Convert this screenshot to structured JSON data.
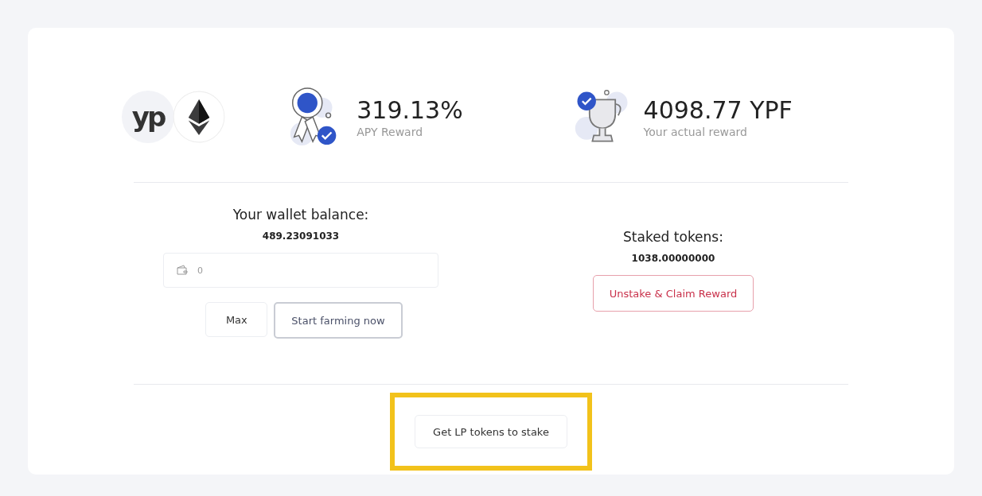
{
  "logo": {
    "text": "yp"
  },
  "stats": [
    {
      "kind": "apy",
      "value": "319.13%",
      "label": "APY Reward"
    },
    {
      "kind": "reward",
      "value": "4098.77 YPF",
      "label": "Your actual reward"
    }
  ],
  "wallet": {
    "title": "Your wallet balance:",
    "balance": "489.23091033",
    "input_placeholder": "0",
    "buttons": [
      "Max",
      "Start farming now"
    ]
  },
  "staked": {
    "title": "Staked tokens:",
    "amount": "1038.00000000",
    "button": "Unstake & Claim Reward"
  },
  "footer_button": {
    "label": "Get LP tokens to stake",
    "highlighted": true
  }
}
